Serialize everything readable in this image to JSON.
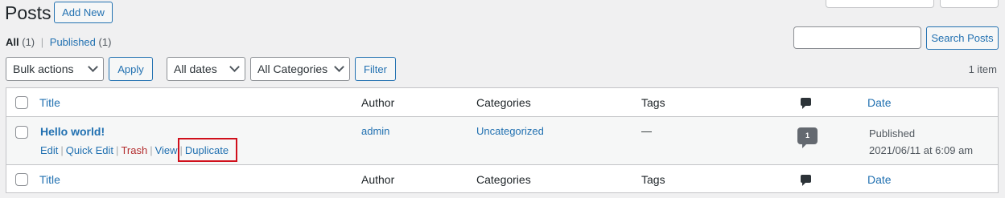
{
  "header": {
    "title": "Posts",
    "add_new": "Add New"
  },
  "views": {
    "all_label": "All",
    "all_count": "(1)",
    "published_label": "Published",
    "published_count": "(1)"
  },
  "search": {
    "value": "",
    "button": "Search Posts"
  },
  "tablenav": {
    "bulk_actions": "Bulk actions",
    "apply": "Apply",
    "dates": "All dates",
    "categories": "All Categories",
    "filter": "Filter",
    "items_count": "1 item"
  },
  "table": {
    "columns": {
      "title": "Title",
      "author": "Author",
      "categories": "Categories",
      "tags": "Tags",
      "comments_icon": "comment-icon",
      "date": "Date"
    },
    "rows": [
      {
        "title": "Hello world!",
        "actions": {
          "edit": "Edit",
          "quick_edit": "Quick Edit",
          "trash": "Trash",
          "view": "View",
          "duplicate": "Duplicate"
        },
        "author": "admin",
        "category": "Uncategorized",
        "tags": "—",
        "comments": "1",
        "date_status": "Published",
        "date_value": "2021/06/11 at 6:09 am"
      }
    ]
  },
  "colors": {
    "accent": "#2271b1",
    "trash": "#b32d2e",
    "highlight": "#d0101c"
  }
}
